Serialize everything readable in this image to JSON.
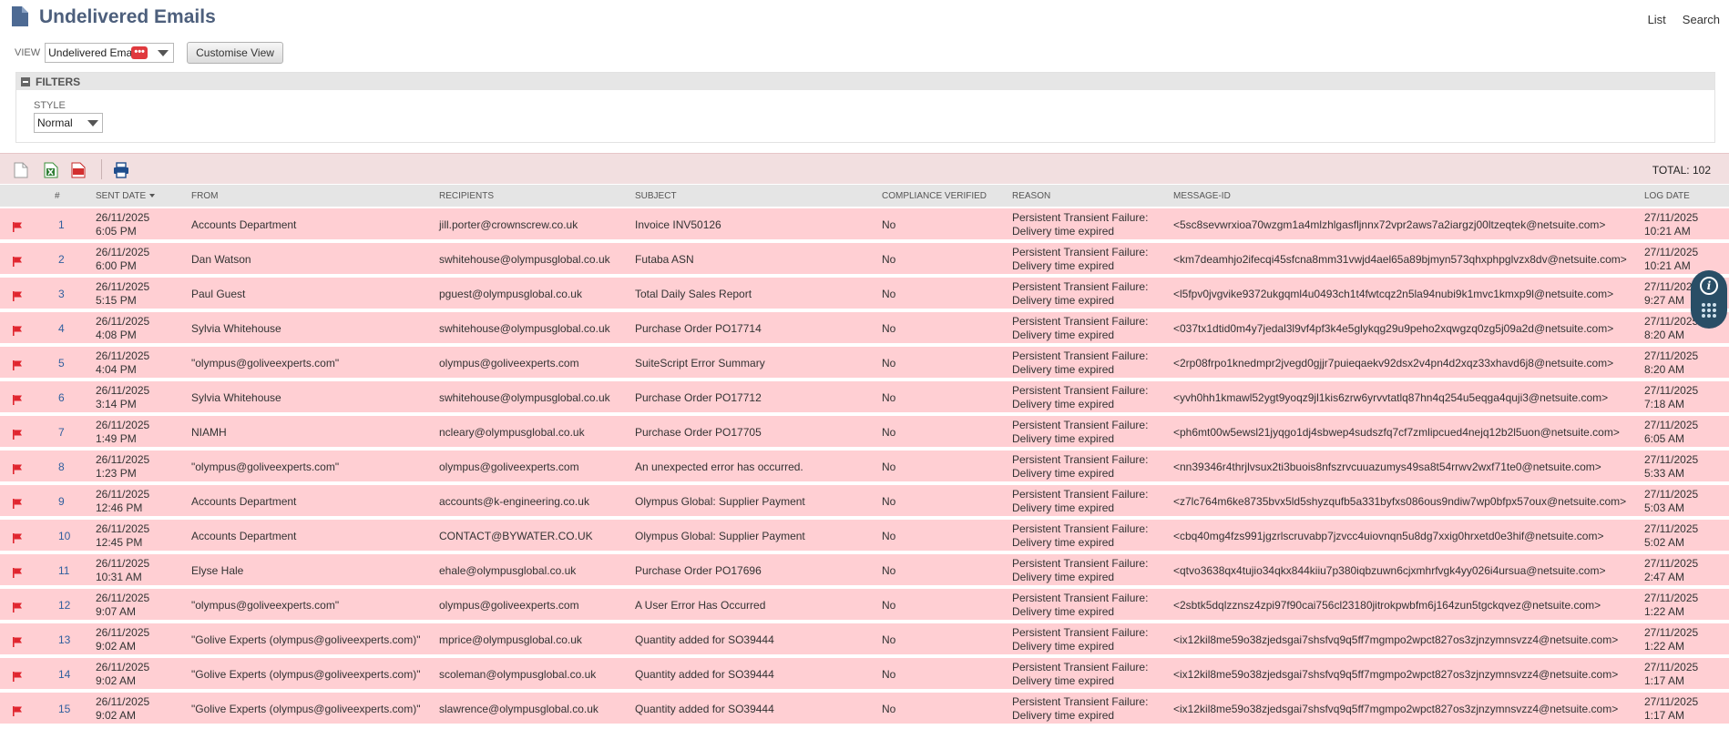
{
  "header": {
    "title": "Undelivered Emails",
    "links": [
      "List",
      "Search"
    ]
  },
  "view": {
    "label": "VIEW",
    "selected": "Undelivered Ema",
    "badge": "•••",
    "customise": "Customise View"
  },
  "filters": {
    "title": "FILTERS",
    "style_label": "STYLE",
    "style_value": "Normal"
  },
  "toolbar": {
    "total": "TOTAL: 102"
  },
  "columns": {
    "num": "#",
    "sent_date": "SENT DATE",
    "from": "FROM",
    "recipients": "RECIPIENTS",
    "subject": "SUBJECT",
    "compliance": "COMPLIANCE VERIFIED",
    "reason": "REASON",
    "message_id": "MESSAGE-ID",
    "log_date": "LOG DATE"
  },
  "colors": {
    "row_bg": "#ffcfd3",
    "toolbar_bg": "#f2dfe0",
    "title": "#4d5f7c",
    "flag": "#e0262f"
  },
  "rows": [
    {
      "num": "1",
      "date": "26/11/2025",
      "time": "6:05 PM",
      "from": "Accounts Department",
      "to": "jill.porter@crownscrew.co.uk",
      "subject": "Invoice INV50126",
      "compliance": "No",
      "reason1": "Persistent Transient Failure:",
      "reason2": "Delivery time expired",
      "msgid": "<5sc8sevwrxioa70wzgm1a4mlzhlgasfljnnx72vpr2aws7a2iargzj00ltzeqtek@netsuite.com>",
      "logdate": "27/11/2025",
      "logtime": "10:21 AM"
    },
    {
      "num": "2",
      "date": "26/11/2025",
      "time": "6:00 PM",
      "from": "Dan Watson",
      "to": "swhitehouse@olympusglobal.co.uk",
      "subject": "Futaba ASN",
      "compliance": "No",
      "reason1": "Persistent Transient Failure:",
      "reason2": "Delivery time expired",
      "msgid": "<km7deamhjo2ifecqi45sfcna8mm31vwjd4ael65a89bjmyn573qhxphpglvzx8dv@netsuite.com>",
      "logdate": "27/11/2025",
      "logtime": "10:21 AM"
    },
    {
      "num": "3",
      "date": "26/11/2025",
      "time": "5:15 PM",
      "from": "Paul Guest",
      "to": "pguest@olympusglobal.co.uk",
      "subject": "Total Daily Sales Report",
      "compliance": "No",
      "reason1": "Persistent Transient Failure:",
      "reason2": "Delivery time expired",
      "msgid": "<l5fpv0jvgvike9372ukgqml4u0493ch1t4fwtcqz2n5la94nubi9k1mvc1kmxp9l@netsuite.com>",
      "logdate": "27/11/2025",
      "logtime": "9:27 AM"
    },
    {
      "num": "4",
      "date": "26/11/2025",
      "time": "4:08 PM",
      "from": "Sylvia Whitehouse",
      "to": "swhitehouse@olympusglobal.co.uk",
      "subject": "Purchase Order PO17714",
      "compliance": "No",
      "reason1": "Persistent Transient Failure:",
      "reason2": "Delivery time expired",
      "msgid": "<037tx1dtid0m4y7jedal3l9vf4pf3k4e5glykqg29u9peho2xqwgzq0zg5j09a2d@netsuite.com>",
      "logdate": "27/11/2025",
      "logtime": "8:20 AM"
    },
    {
      "num": "5",
      "date": "26/11/2025",
      "time": "4:04 PM",
      "from": "\"olympus@goliveexperts.com\"",
      "to": "olympus@goliveexperts.com",
      "subject": "SuiteScript Error Summary",
      "compliance": "No",
      "reason1": "Persistent Transient Failure:",
      "reason2": "Delivery time expired",
      "msgid": "<2rp08frpo1knedmpr2jvegd0gjjr7puieqaekv92dsx2v4pn4d2xqz33xhavd6j8@netsuite.com>",
      "logdate": "27/11/2025",
      "logtime": "8:20 AM"
    },
    {
      "num": "6",
      "date": "26/11/2025",
      "time": "3:14 PM",
      "from": "Sylvia Whitehouse",
      "to": "swhitehouse@olympusglobal.co.uk",
      "subject": "Purchase Order PO17712",
      "compliance": "No",
      "reason1": "Persistent Transient Failure:",
      "reason2": "Delivery time expired",
      "msgid": "<yvh0hh1kmawl52ygt9yoqz9jl1kis6zrw6yrvvtatlq87hn4q254u5eqga4quji3@netsuite.com>",
      "logdate": "27/11/2025",
      "logtime": "7:18 AM"
    },
    {
      "num": "7",
      "date": "26/11/2025",
      "time": "1:49 PM",
      "from": "NIAMH",
      "to": "ncleary@olympusglobal.co.uk",
      "subject": "Purchase Order PO17705",
      "compliance": "No",
      "reason1": "Persistent Transient Failure:",
      "reason2": "Delivery time expired",
      "msgid": "<ph6mt00w5ewsl21jyqgo1dj4sbwep4sudszfq7cf7zmlipcued4nejq12b2l5uon@netsuite.com>",
      "logdate": "27/11/2025",
      "logtime": "6:05 AM"
    },
    {
      "num": "8",
      "date": "26/11/2025",
      "time": "1:23 PM",
      "from": "\"olympus@goliveexperts.com\"",
      "to": "olympus@goliveexperts.com",
      "subject": "An unexpected error has occurred.",
      "compliance": "No",
      "reason1": "Persistent Transient Failure:",
      "reason2": "Delivery time expired",
      "msgid": "<nn39346r4thrjlvsux2ti3buois8nfszrvcuuazumys49sa8t54rrwv2wxf71te0@netsuite.com>",
      "logdate": "27/11/2025",
      "logtime": "5:33 AM"
    },
    {
      "num": "9",
      "date": "26/11/2025",
      "time": "12:46 PM",
      "from": "Accounts Department",
      "to": "accounts@k-engineering.co.uk",
      "subject": "Olympus Global: Supplier Payment",
      "compliance": "No",
      "reason1": "Persistent Transient Failure:",
      "reason2": "Delivery time expired",
      "msgid": "<z7lc764m6ke8735bvx5ld5shyzqufb5a331byfxs086ous9ndiw7wp0bfpx57oux@netsuite.com>",
      "logdate": "27/11/2025",
      "logtime": "5:03 AM"
    },
    {
      "num": "10",
      "date": "26/11/2025",
      "time": "12:45 PM",
      "from": "Accounts Department",
      "to": "CONTACT@BYWATER.CO.UK",
      "subject": "Olympus Global: Supplier Payment",
      "compliance": "No",
      "reason1": "Persistent Transient Failure:",
      "reason2": "Delivery time expired",
      "msgid": "<cbq40mg4fzs991jgzrlscruvabp7jzvcc4uiovnqn5u8dg7xxig0hrxetd0e3hif@netsuite.com>",
      "logdate": "27/11/2025",
      "logtime": "5:02 AM"
    },
    {
      "num": "11",
      "date": "26/11/2025",
      "time": "10:31 AM",
      "from": "Elyse Hale",
      "to": "ehale@olympusglobal.co.uk",
      "subject": "Purchase Order PO17696",
      "compliance": "No",
      "reason1": "Persistent Transient Failure:",
      "reason2": "Delivery time expired",
      "msgid": "<qtvo3638qx4tujio34qkx844kiiu7p380iqbzuwn6cjxmhrfvgk4yy026i4ursua@netsuite.com>",
      "logdate": "27/11/2025",
      "logtime": "2:47 AM"
    },
    {
      "num": "12",
      "date": "26/11/2025",
      "time": "9:07 AM",
      "from": "\"olympus@goliveexperts.com\"",
      "to": "olympus@goliveexperts.com",
      "subject": "A User Error Has Occurred",
      "compliance": "No",
      "reason1": "Persistent Transient Failure:",
      "reason2": "Delivery time expired",
      "msgid": "<2sbtk5dqlzznsz4zpi97f90cai756cl23180jitrokpwbfm6j164zun5tgckqvez@netsuite.com>",
      "logdate": "27/11/2025",
      "logtime": "1:22 AM"
    },
    {
      "num": "13",
      "date": "26/11/2025",
      "time": "9:02 AM",
      "from": "\"Golive Experts (olympus@goliveexperts.com)\"",
      "to": "mprice@olympusglobal.co.uk",
      "subject": "Quantity added for SO39444",
      "compliance": "No",
      "reason1": "Persistent Transient Failure:",
      "reason2": "Delivery time expired",
      "msgid": "<ix12kil8me59o38zjedsgai7shsfvq9q5ff7mgmpo2wpct827os3zjnzymnsvzz4@netsuite.com>",
      "logdate": "27/11/2025",
      "logtime": "1:22 AM"
    },
    {
      "num": "14",
      "date": "26/11/2025",
      "time": "9:02 AM",
      "from": "\"Golive Experts (olympus@goliveexperts.com)\"",
      "to": "scoleman@olympusglobal.co.uk",
      "subject": "Quantity added for SO39444",
      "compliance": "No",
      "reason1": "Persistent Transient Failure:",
      "reason2": "Delivery time expired",
      "msgid": "<ix12kil8me59o38zjedsgai7shsfvq9q5ff7mgmpo2wpct827os3zjnzymnsvzz4@netsuite.com>",
      "logdate": "27/11/2025",
      "logtime": "1:17 AM"
    },
    {
      "num": "15",
      "date": "26/11/2025",
      "time": "9:02 AM",
      "from": "\"Golive Experts (olympus@goliveexperts.com)\"",
      "to": "slawrence@olympusglobal.co.uk",
      "subject": "Quantity added for SO39444",
      "compliance": "No",
      "reason1": "Persistent Transient Failure:",
      "reason2": "Delivery time expired",
      "msgid": "<ix12kil8me59o38zjedsgai7shsfvq9q5ff7mgmpo2wpct827os3zjnzymnsvzz4@netsuite.com>",
      "logdate": "27/11/2025",
      "logtime": "1:17 AM"
    }
  ]
}
